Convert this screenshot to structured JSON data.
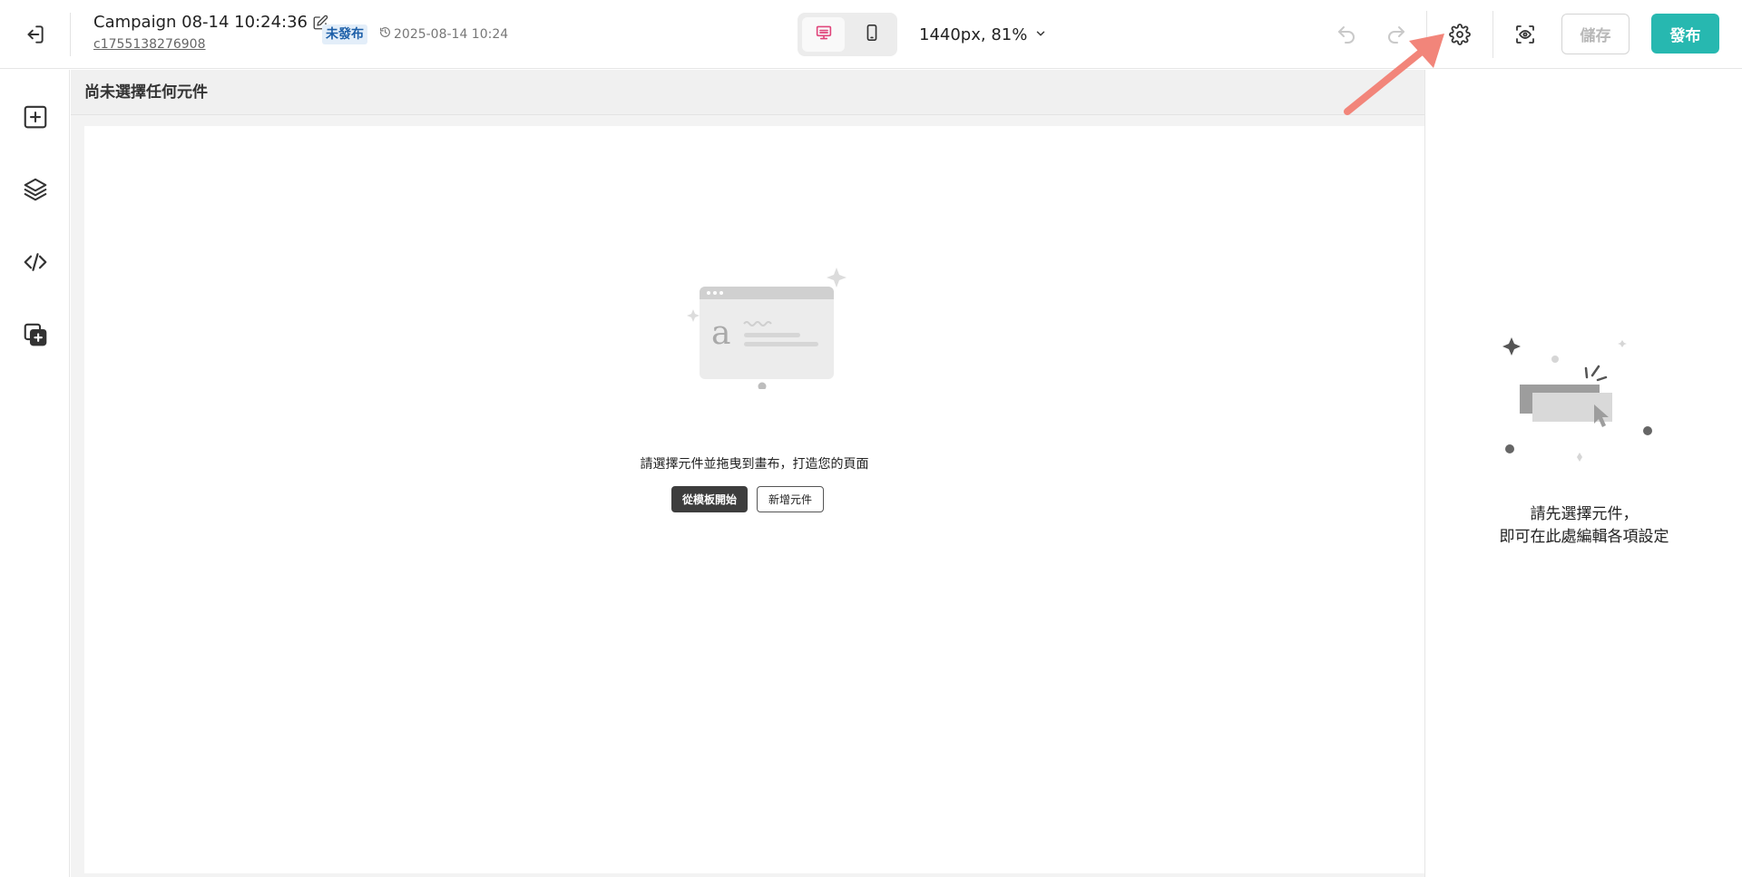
{
  "header": {
    "title": "Campaign 08-14 10:24:36",
    "campaign_id": "c1755138276908",
    "status": "未發布",
    "timestamp": "2025-08-14 10:24",
    "zoom": "1440px, 81%",
    "save_label": "儲存",
    "publish_label": "發布",
    "active_device": "desktop"
  },
  "canvas": {
    "toolbar_label": "尚未選擇任何元件",
    "empty_message": "請選擇元件並拖曳到畫布，打造您的頁面",
    "start_from_template_label": "從模板開始",
    "add_component_label": "新增元件"
  },
  "right_panel": {
    "hint_line1": "請先選擇元件，",
    "hint_line2": "即可在此處編輯各項設定"
  },
  "colors": {
    "accent": "#27b8b0",
    "status_badge_bg": "#e3eef9",
    "status_badge_text": "#1d5fa8",
    "desktop_icon_active": "#e0457b",
    "annotation_arrow": "#f2857a"
  },
  "icons": {
    "exit": "exit-icon",
    "edit": "pencil-icon",
    "history": "clock-history-icon",
    "desktop": "desktop-icon",
    "mobile": "mobile-icon",
    "chevron": "chevron-down-icon",
    "undo": "undo-icon",
    "redo": "redo-icon",
    "settings": "gear-icon",
    "preview": "eye-preview-icon",
    "add": "plus-square-icon",
    "layers": "layers-icon",
    "code": "code-icon",
    "assets": "add-asset-icon"
  }
}
